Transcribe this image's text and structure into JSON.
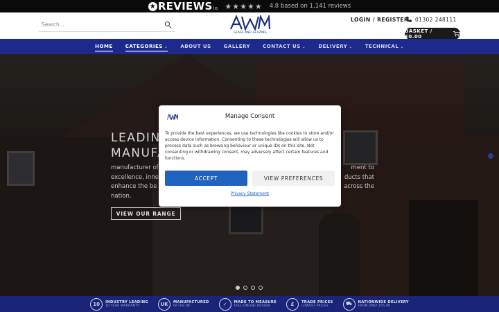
{
  "reviews_bar": {
    "brand": "REVIEWS",
    "brand_suffix": "io",
    "stars": "★★★★★",
    "rating_text": "4.8 based on 1,141 reviews"
  },
  "header": {
    "search_placeholder": "Search...",
    "logo_letters": "AWM",
    "logo_subtext": "GLASS AND GLAZING",
    "login_label": "LOGIN / REGISTER",
    "phone": "01302 248111",
    "basket_label": "BASKET / £0.00"
  },
  "nav": {
    "items": [
      {
        "label": "HOME",
        "dropdown": false
      },
      {
        "label": "CATEGORIES",
        "dropdown": true
      },
      {
        "label": "ABOUT US",
        "dropdown": false
      },
      {
        "label": "GALLERY",
        "dropdown": false
      },
      {
        "label": "CONTACT US",
        "dropdown": true
      },
      {
        "label": "DELIVERY",
        "dropdown": true
      },
      {
        "label": "TECHNICAL",
        "dropdown": true
      }
    ],
    "chevron": "⌄"
  },
  "hero": {
    "title_line1": "LEADING",
    "title_line2": "MANUFA",
    "text_line1_left": "manufacturer of",
    "text_line1_right": "ment to",
    "text_line2_left": "excellence, inne",
    "text_line2_right": "ducts that",
    "text_line3_left": "enhance the be",
    "text_line3_right": "across the",
    "text_line4_left": "nation.",
    "button_label": "VIEW OUR RANGE",
    "slides": 4,
    "active_slide": 1
  },
  "usps": [
    {
      "icon": "10",
      "title": "INDUSTRY LEADING",
      "sub": "10 YEAR WARRANTY"
    },
    {
      "icon": "UK",
      "title": "MANUFACTURED",
      "sub": "IN THE UK"
    },
    {
      "icon": "✓",
      "title": "MADE TO MEASURE",
      "sub": "FULL ONLINE DESIGN"
    },
    {
      "icon": "£",
      "title": "TRADE PRICES",
      "sub": "LOWEST PRICES"
    },
    {
      "icon": "⛟",
      "title": "NATIONWIDE DELIVERY",
      "sub": "FROM ONLY £55.00"
    }
  ],
  "consent": {
    "title": "Manage Consent",
    "body": "To provide the best experiences, we use technologies like cookies to store and/or access device information. Consenting to these technologies will allow us to process data such as browsing behaviour or unique IDs on this site. Not consenting or withdrawing consent, may adversely affect certain features and functions.",
    "accept_label": "ACCEPT",
    "prefs_label": "VIEW PREFERENCES",
    "privacy_label": "Privacy Statement"
  },
  "colors": {
    "nav_blue": "#1d2a8c",
    "usp_blue": "#1b2577",
    "accept_blue": "#1f63bf",
    "logo_blue": "#1a2f7a"
  }
}
